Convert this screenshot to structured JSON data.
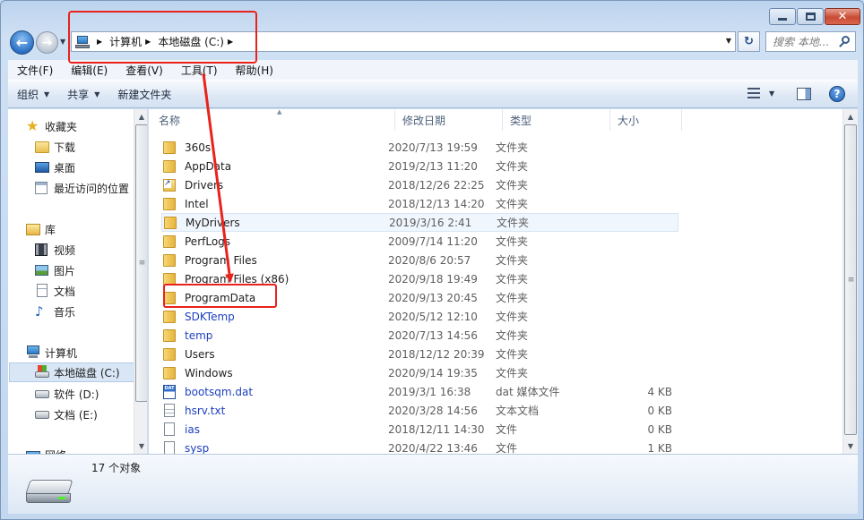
{
  "window": {
    "minimize_label": "—",
    "close_label": "✕"
  },
  "nav": {
    "back_icon": "arrow-left-icon",
    "forward_icon": "arrow-right-icon"
  },
  "address": {
    "crumbs": [
      "计算机",
      "本地磁盘 (C:)"
    ]
  },
  "search": {
    "placeholder": "搜索 本地..."
  },
  "menu": [
    "文件(F)",
    "编辑(E)",
    "查看(V)",
    "工具(T)",
    "帮助(H)"
  ],
  "toolbar": {
    "organize": "组织",
    "share": "共享",
    "new_folder": "新建文件夹",
    "help": "?"
  },
  "sidebar": {
    "favorites": "收藏夹",
    "downloads": "下载",
    "desktop": "桌面",
    "recent": "最近访问的位置",
    "libraries": "库",
    "videos": "视频",
    "pictures": "图片",
    "documents": "文档",
    "music": "音乐",
    "computer": "计算机",
    "drive_c": "本地磁盘 (C:)",
    "drive_d": "软件 (D:)",
    "drive_e": "文档 (E:)",
    "network": "网络"
  },
  "columns": {
    "name": "名称",
    "date": "修改日期",
    "type": "类型",
    "size": "大小"
  },
  "files": [
    {
      "name": "360s",
      "date": "2020/7/13 19:59",
      "type": "文件夹",
      "size": "",
      "icon": "folder",
      "blue": false
    },
    {
      "name": "AppData",
      "date": "2019/2/13 11:20",
      "type": "文件夹",
      "size": "",
      "icon": "folder",
      "blue": false
    },
    {
      "name": "Drivers",
      "date": "2018/12/26 22:25",
      "type": "文件夹",
      "size": "",
      "icon": "shortcut",
      "blue": false
    },
    {
      "name": "Intel",
      "date": "2018/12/13 14:20",
      "type": "文件夹",
      "size": "",
      "icon": "folder",
      "blue": false
    },
    {
      "name": "MyDrivers",
      "date": "2019/3/16 2:41",
      "type": "文件夹",
      "size": "",
      "icon": "folder",
      "blue": false
    },
    {
      "name": "PerfLogs",
      "date": "2009/7/14 11:20",
      "type": "文件夹",
      "size": "",
      "icon": "folder",
      "blue": false
    },
    {
      "name": "Program Files",
      "date": "2020/8/6 20:57",
      "type": "文件夹",
      "size": "",
      "icon": "folder",
      "blue": false
    },
    {
      "name": "Program Files (x86)",
      "date": "2020/9/18 19:49",
      "type": "文件夹",
      "size": "",
      "icon": "folder",
      "blue": false
    },
    {
      "name": "ProgramData",
      "date": "2020/9/13 20:45",
      "type": "文件夹",
      "size": "",
      "icon": "folder",
      "blue": false
    },
    {
      "name": "SDKTemp",
      "date": "2020/5/12 12:10",
      "type": "文件夹",
      "size": "",
      "icon": "folder",
      "blue": true
    },
    {
      "name": "temp",
      "date": "2020/7/13 14:56",
      "type": "文件夹",
      "size": "",
      "icon": "folder",
      "blue": true
    },
    {
      "name": "Users",
      "date": "2018/12/12 20:39",
      "type": "文件夹",
      "size": "",
      "icon": "folder",
      "blue": false
    },
    {
      "name": "Windows",
      "date": "2020/9/14 19:35",
      "type": "文件夹",
      "size": "",
      "icon": "folder",
      "blue": false
    },
    {
      "name": "bootsqm.dat",
      "date": "2019/3/1 16:38",
      "type": "dat 媒体文件",
      "size": "4 KB",
      "icon": "dat",
      "blue": true
    },
    {
      "name": "hsrv.txt",
      "date": "2020/3/28 14:56",
      "type": "文本文档",
      "size": "0 KB",
      "icon": "txt",
      "blue": true
    },
    {
      "name": "ias",
      "date": "2018/12/11 14:30",
      "type": "文件",
      "size": "0 KB",
      "icon": "blank",
      "blue": true
    },
    {
      "name": "sysp",
      "date": "2020/4/22 13:46",
      "type": "文件",
      "size": "1 KB",
      "icon": "blank",
      "blue": true
    }
  ],
  "status": {
    "count": "17 个对象"
  },
  "colors": {
    "annotation": "#e8231c",
    "link_blue": "#1d3fbf"
  }
}
